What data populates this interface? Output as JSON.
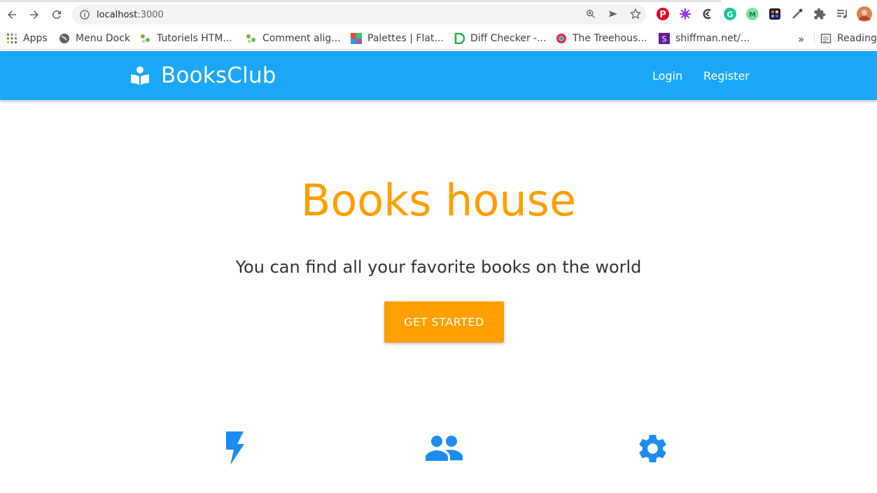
{
  "browser": {
    "url_host": "localhost",
    "url_port": ":3000",
    "bookmarks": [
      {
        "label": "Apps"
      },
      {
        "label": "Menu Dock"
      },
      {
        "label": "Tutoriels HTM..."
      },
      {
        "label": "Comment alig..."
      },
      {
        "label": "Palettes | Flat..."
      },
      {
        "label": "Diff Checker -..."
      },
      {
        "label": "The Treehous..."
      },
      {
        "label": "shiffman.net/..."
      }
    ],
    "more": "»",
    "reading_list": "Reading"
  },
  "app": {
    "brand": "BooksClub",
    "nav": {
      "login": "Login",
      "register": "Register"
    },
    "hero": {
      "title": "Books house",
      "subtitle": "You can find all your favorite books on the world",
      "cta": "GET STARTED"
    },
    "features": [
      {
        "icon": "flash-icon"
      },
      {
        "icon": "people-icon"
      },
      {
        "icon": "gear-icon"
      }
    ]
  },
  "colors": {
    "appbar": "#1aa8f6",
    "accent": "#ff9f00",
    "feature_icon": "#1d8cf2"
  }
}
